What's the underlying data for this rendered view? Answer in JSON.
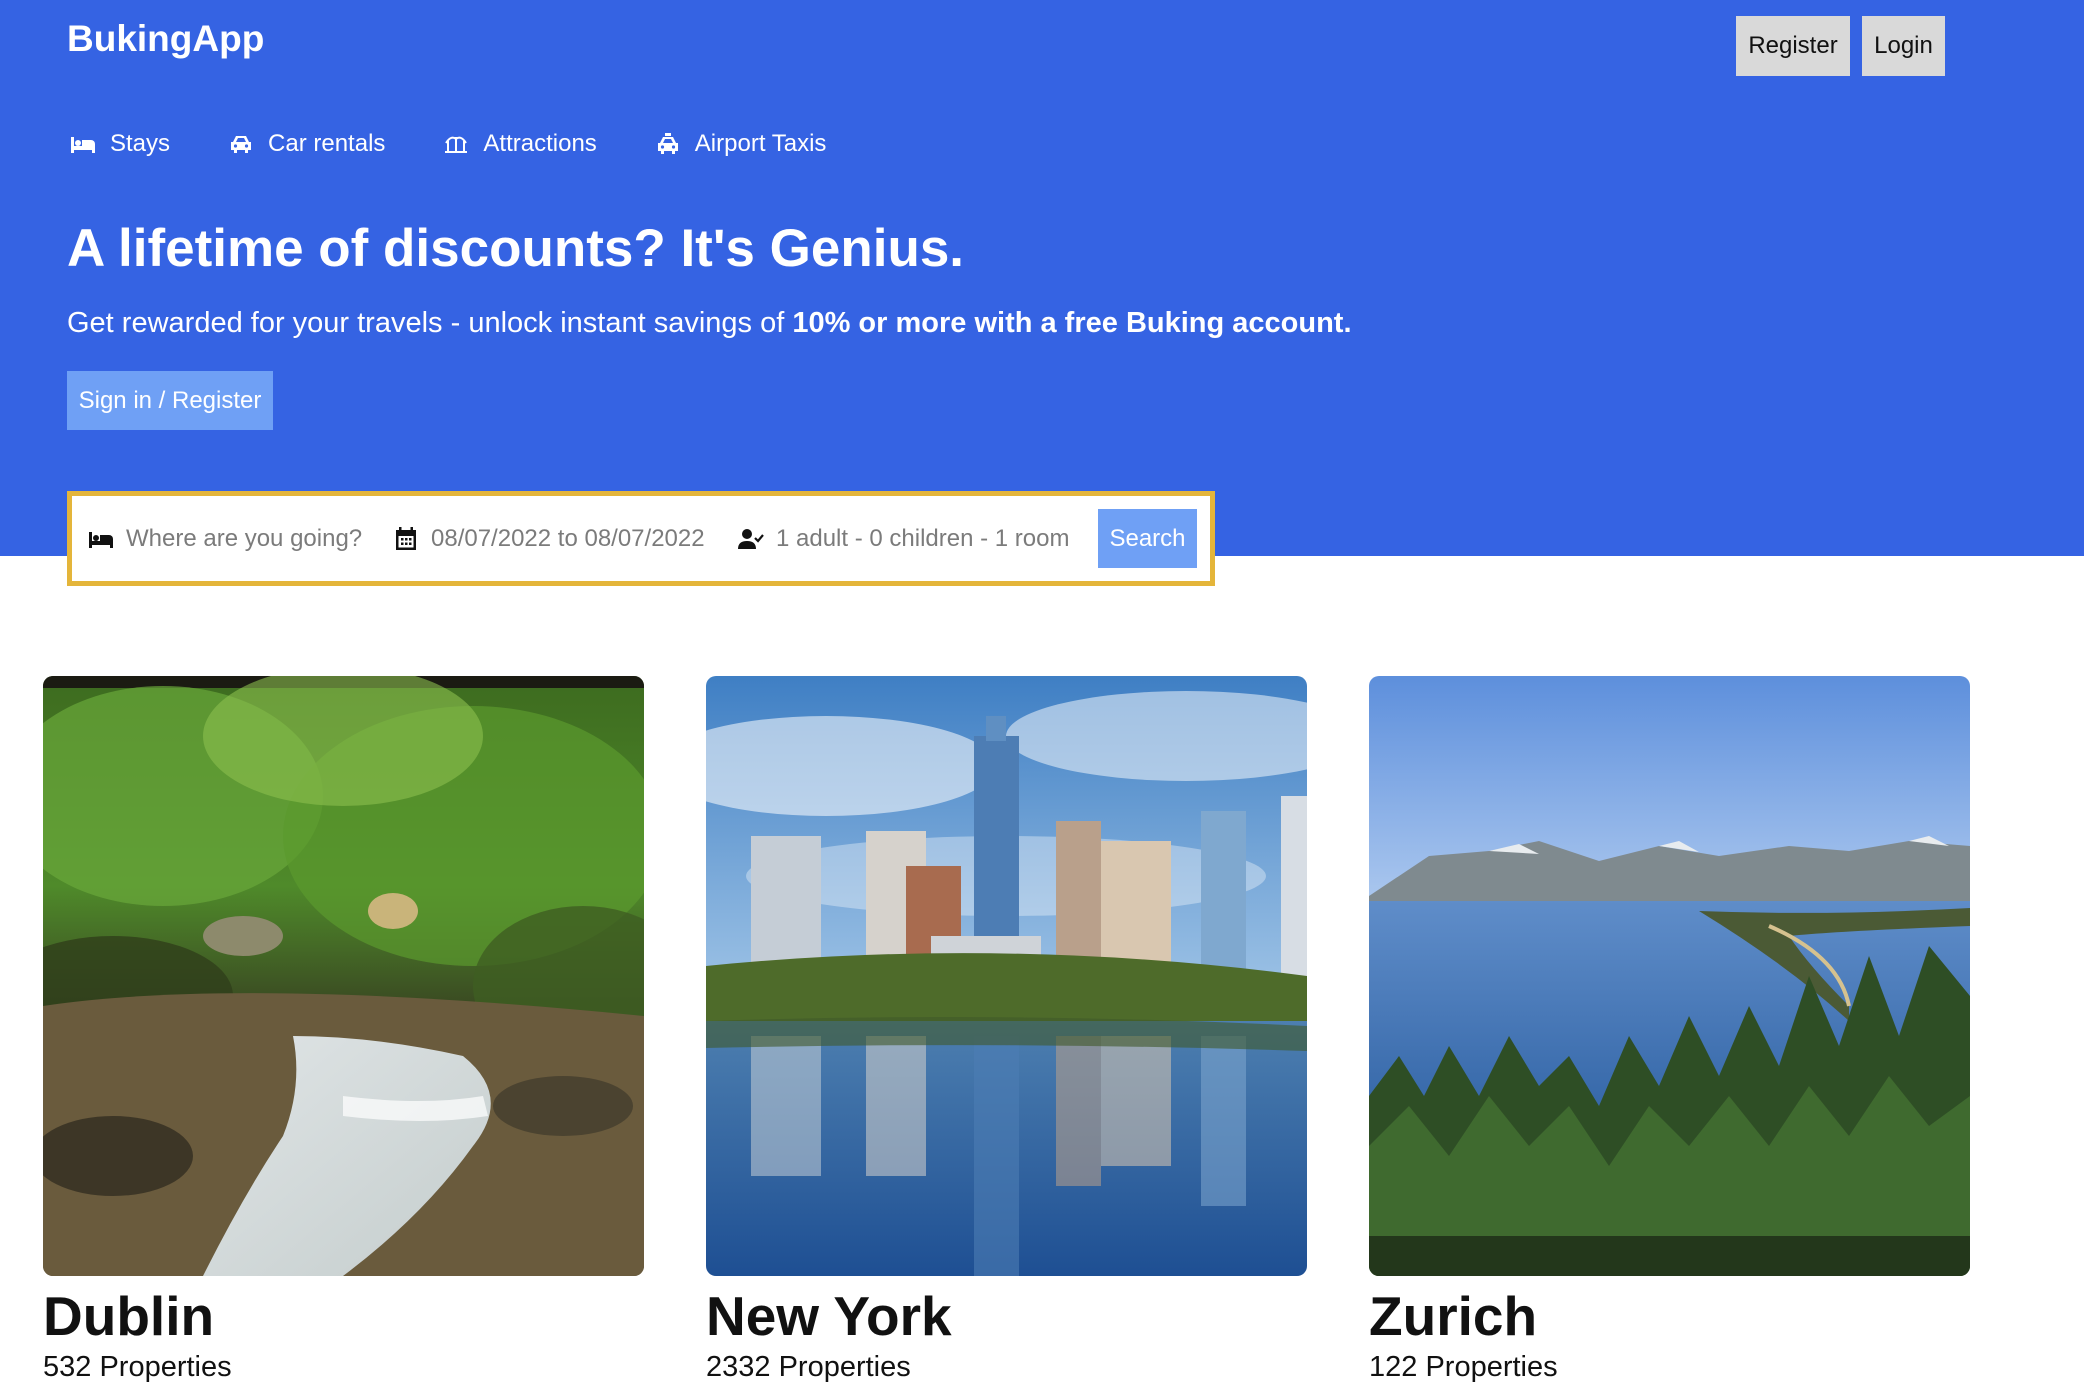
{
  "app": {
    "title": "BukingApp"
  },
  "header": {
    "register_label": "Register",
    "login_label": "Login",
    "nav": [
      {
        "label": "Stays",
        "icon": "bed-icon"
      },
      {
        "label": "Car rentals",
        "icon": "car-icon"
      },
      {
        "label": "Attractions",
        "icon": "attractions-icon"
      },
      {
        "label": "Airport Taxis",
        "icon": "taxi-icon"
      }
    ],
    "headline": "A lifetime of discounts? It's Genius.",
    "subline_regular": "Get rewarded for your travels - unlock instant savings of ",
    "subline_bold": "10% or more with a free Buking account.",
    "signin_label": "Sign in / Register"
  },
  "search": {
    "destination_placeholder": "Where are you going?",
    "dates_value": "08/07/2022 to 08/07/2022",
    "guests_value": "1 adult - 0 children - 1 room",
    "button_label": "Search"
  },
  "featured": [
    {
      "city": "Dublin",
      "properties": "532 Properties"
    },
    {
      "city": "New York",
      "properties": "2332 Properties"
    },
    {
      "city": "Zurich",
      "properties": "122 Properties"
    }
  ],
  "colors": {
    "header_bg": "#3563e3",
    "button_blue": "#6fa0f5",
    "search_border": "#e4b53a",
    "top_button_bg": "#d9d9d9"
  }
}
